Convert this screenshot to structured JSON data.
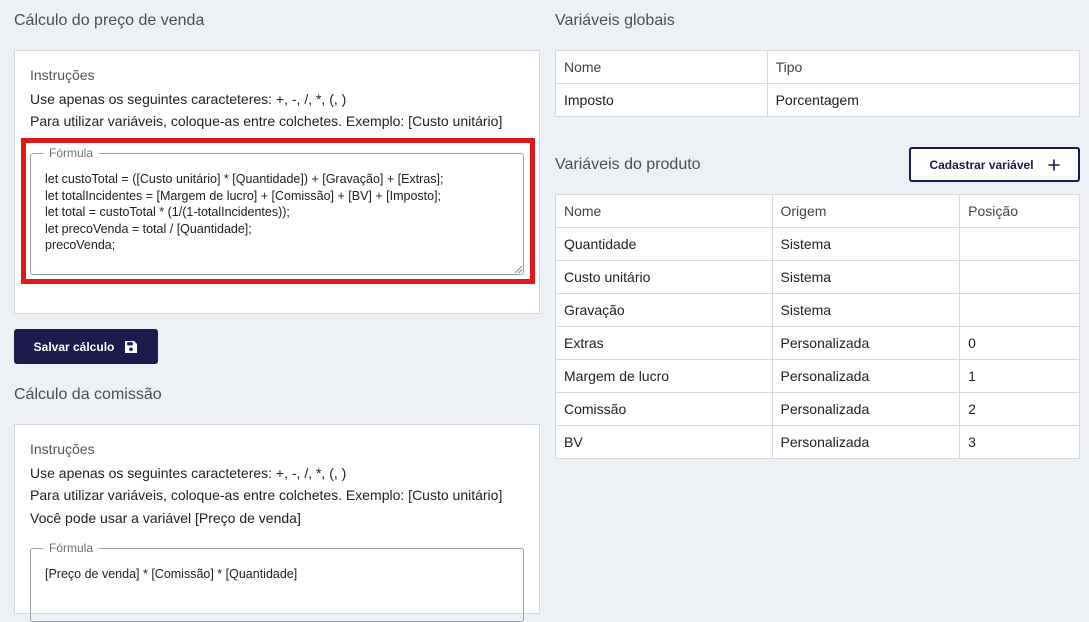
{
  "sale_price": {
    "title": "Cálculo do preço de venda",
    "instructions_title": "Instruções",
    "instructions_lines": [
      "Use apenas os seguintes caracteteres: +, -, /, *, (, )",
      "Para utilizar variáveis, coloque-as entre colchetes. Exemplo: [Custo unitário]"
    ],
    "formula_label": "Fórmula",
    "formula_value": "let custoTotal = ([Custo unitário] * [Quantidade]) + [Gravação] + [Extras];\nlet totalIncidentes = [Margem de lucro] + [Comissão] + [BV] + [Imposto];\nlet total = custoTotal * (1/(1-totalIncidentes));\nlet precoVenda = total / [Quantidade];\nprecoVenda;",
    "save_label": "Salvar cálculo"
  },
  "commission": {
    "title": "Cálculo da comissão",
    "instructions_title": "Instruções",
    "instructions_lines": [
      "Use apenas os seguintes caracteteres: +, -, /, *, (, )",
      "Para utilizar variáveis, coloque-as entre colchetes. Exemplo: [Custo unitário]",
      "Você pode usar a variável [Preço de venda]"
    ],
    "formula_label": "Fórmula",
    "formula_value": "[Preço de venda] * [Comissão] * [Quantidade]"
  },
  "global_vars": {
    "title": "Variáveis globais",
    "headers": [
      "Nome",
      "Tipo"
    ],
    "rows": [
      [
        "Imposto",
        "Porcentagem"
      ]
    ]
  },
  "product_vars": {
    "title": "Variáveis do produto",
    "add_label": "Cadastrar variável",
    "headers": [
      "Nome",
      "Origem",
      "Posição"
    ],
    "rows": [
      [
        "Quantidade",
        "Sistema",
        ""
      ],
      [
        "Custo unitário",
        "Sistema",
        ""
      ],
      [
        "Gravação",
        "Sistema",
        ""
      ],
      [
        "Extras",
        "Personalizada",
        "0"
      ],
      [
        "Margem de lucro",
        "Personalizada",
        "1"
      ],
      [
        "Comissão",
        "Personalizada",
        "2"
      ],
      [
        "BV",
        "Personalizada",
        "3"
      ]
    ]
  },
  "colors": {
    "primary": "#1d1a4d",
    "highlight": "#e0191b",
    "background": "#edf0f5"
  }
}
